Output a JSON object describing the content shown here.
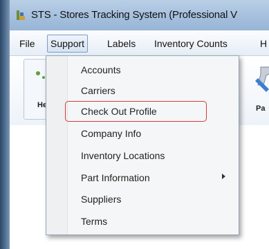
{
  "window": {
    "title": "STS - Stores Tracking System (Professional V",
    "icon": "sts-app-icon"
  },
  "menubar": {
    "items": [
      {
        "label": "File"
      },
      {
        "label": "Support"
      },
      {
        "label": "Labels"
      },
      {
        "label": "Inventory Counts"
      },
      {
        "label": "H"
      }
    ]
  },
  "toolbar": {
    "left_label": "He",
    "right_label": "Pa"
  },
  "support_menu": {
    "items": [
      {
        "label": "Accounts"
      },
      {
        "label": "Carriers"
      },
      {
        "label": "Check Out Profile"
      },
      {
        "label": "Company Info"
      },
      {
        "label": "Inventory Locations"
      },
      {
        "label": "Part Information",
        "submenu": true
      },
      {
        "label": "Suppliers"
      },
      {
        "label": "Terms"
      }
    ],
    "highlighted": "Check Out Profile",
    "highlight_color": "#d63a3a"
  }
}
